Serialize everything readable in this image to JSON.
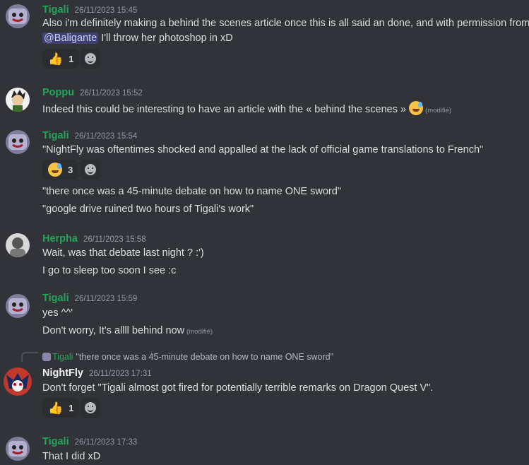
{
  "messages": [
    {
      "author": "Tigali",
      "timestamp": "26/11/2023 15:45",
      "line1_pre": "Also i'm definitely making a behind the scenes article once this is all said an done, and with permission from",
      "mention": "@Baligante",
      "line2_post": " I'll throw her photoshop in xD",
      "reaction_count": "1"
    },
    {
      "author": "Poppu",
      "timestamp": "26/11/2023 15:52",
      "text": "Indeed this could be interesting to have an article with the « behind the scenes »",
      "edited": "(modifié)"
    },
    {
      "author": "Tigali",
      "timestamp": "26/11/2023 15:54",
      "text": "\"NightFly was oftentimes shocked and appalled at the lack of official game translations to French\"",
      "reaction_count": "3",
      "followups": [
        "\"there once was a 45-minute debate on how to name ONE sword\"",
        "\"google drive ruined two hours of Tigali's work\""
      ]
    },
    {
      "author": "Herpha",
      "timestamp": "26/11/2023 15:58",
      "text": "Wait, was that debate last night ? :')",
      "followups": [
        "I go to sleep too soon I see :c"
      ]
    },
    {
      "author": "Tigali",
      "timestamp": "26/11/2023 15:59",
      "text": "yes ^^'",
      "followup": "Don't worry, It's allll behind now",
      "edited": "(modifié)"
    },
    {
      "reply_author": "Tigali",
      "reply_text": "\"there once was a 45-minute debate on how to name ONE sword\"",
      "author": "NightFly",
      "timestamp": "26/11/2023 17:31",
      "text": "Don't forget \"Tigali almost got fired for potentially terrible remarks on Dragon Quest V\".",
      "reaction_count": "1"
    },
    {
      "author": "Tigali",
      "timestamp": "26/11/2023 17:33",
      "text": "That I did xD"
    }
  ],
  "colors": {
    "background": "#313338",
    "author_green": "#23a55a",
    "author_white": "#f2f3f5",
    "mention_bg": "#3c4270"
  },
  "icons": {
    "thumbs_up": "👍",
    "sweat_smile": "sweat-smile-emoji",
    "add_reaction": "add-reaction-icon"
  }
}
